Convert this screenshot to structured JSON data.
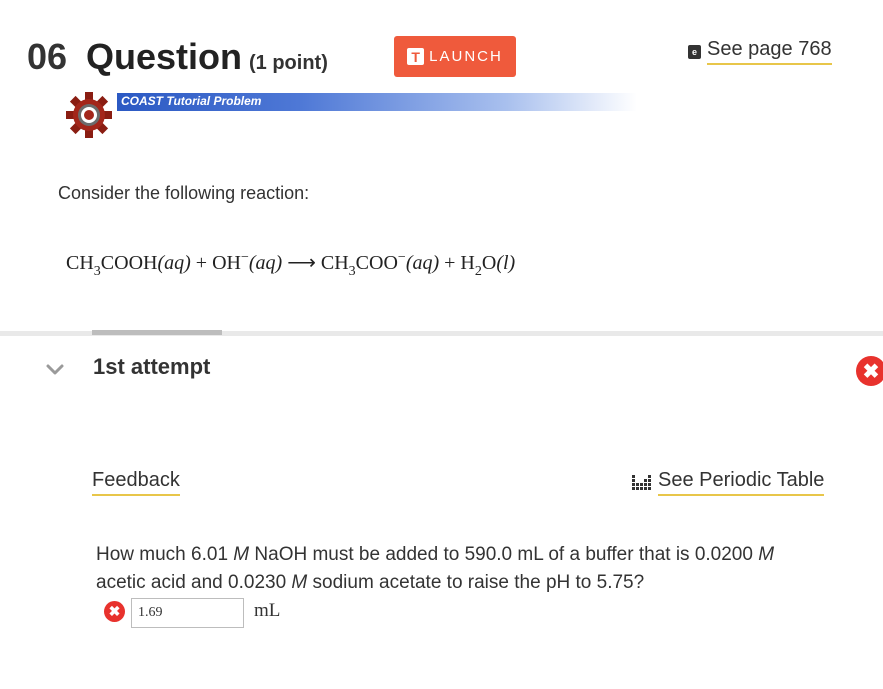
{
  "header": {
    "question_number": "06",
    "question_word": "Question",
    "points": "(1 point)",
    "launch_label": "LAUNCH",
    "launch_icon_letter": "T",
    "see_page": "See page 768"
  },
  "tutorial": {
    "banner": "COAST Tutorial Problem"
  },
  "prompt": {
    "consider": "Consider the following reaction:"
  },
  "reaction": {
    "r1": "CH",
    "r1_sub": "3",
    "r1_rest": "COOH",
    "r1_state": "(aq)",
    "plus1": "+",
    "r2": "OH",
    "r2_sup": "−",
    "r2_state": "(aq)",
    "arrow": "⟶",
    "p1": "CH",
    "p1_sub": "3",
    "p1_rest": "COO",
    "p1_sup": "−",
    "p1_state": "(aq)",
    "plus2": "+",
    "p2": "H",
    "p2_sub": "2",
    "p2_rest": "O",
    "p2_state": "(l)"
  },
  "attempt": {
    "label": "1st attempt"
  },
  "links": {
    "feedback": "Feedback",
    "periodic": "See Periodic Table"
  },
  "question": {
    "p1": "How much 6.01 ",
    "m1": "M",
    "p2": " NaOH must be added to 590.0 mL of a buffer that is 0.0200 ",
    "m2": "M",
    "p3": " acetic acid and 0.0230 ",
    "m3": "M",
    "p4": "  sodium acetate to raise the pH to 5.75?"
  },
  "answer": {
    "value": "1.69",
    "unit": "mL"
  },
  "colors": {
    "accent": "#ef5a3c",
    "error": "#e8322d",
    "link_underline": "#e8c64a",
    "banner_blue": "#2b59c3"
  },
  "icons": {
    "chevron": "chevron-down-icon",
    "error": "x-circle-icon",
    "book": "book-icon",
    "gear": "gear-icon",
    "periodic": "periodic-table-icon"
  }
}
